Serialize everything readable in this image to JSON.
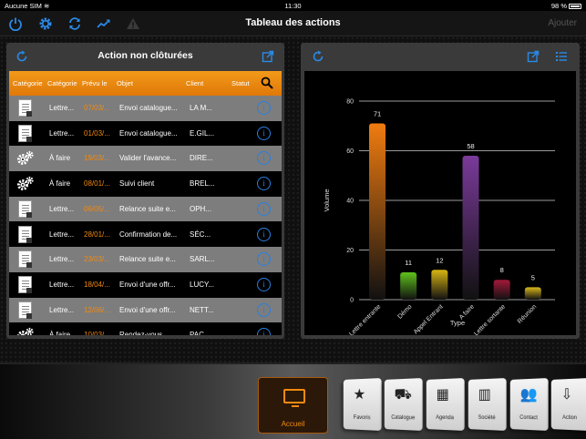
{
  "status_bar": {
    "carrier": "Aucune SIM",
    "time": "11:30",
    "battery": "98 %"
  },
  "nav": {
    "title": "Tableau des actions",
    "add_label": "Ajouter",
    "icons": [
      "power-icon",
      "gear-icon",
      "sync-icon",
      "trend-icon",
      "warning-icon"
    ]
  },
  "left_panel": {
    "title": "Action non clôturées",
    "columns": [
      "Catégorie",
      "Catégorie",
      "Prévu le",
      "Objet",
      "Client",
      "Statut"
    ],
    "rows": [
      {
        "icon": "document-icon",
        "category": "Lettre...",
        "date": "07/03/...",
        "object": "Envoi catalogue...",
        "client": "LA M...",
        "shade": "gray"
      },
      {
        "icon": "document-icon",
        "category": "Lettre...",
        "date": "01/03/...",
        "object": "Envoi catalogue...",
        "client": "E.GIL...",
        "shade": "black"
      },
      {
        "icon": "gears-icon",
        "category": "À faire",
        "date": "19/03/...",
        "object": "Valider l'avance...",
        "client": "DIRE...",
        "shade": "gray"
      },
      {
        "icon": "gears-icon",
        "category": "À faire",
        "date": "08/01/...",
        "object": "Suivi client",
        "client": "BREL...",
        "shade": "black"
      },
      {
        "icon": "document-icon",
        "category": "Lettre...",
        "date": "06/05/...",
        "object": "Relance suite e...",
        "client": "OPH...",
        "shade": "gray"
      },
      {
        "icon": "document-icon",
        "category": "Lettre...",
        "date": "28/01/...",
        "object": "Confirmation de...",
        "client": "SÉC...",
        "shade": "black"
      },
      {
        "icon": "document-icon",
        "category": "Lettre...",
        "date": "23/03/...",
        "object": "Relance suite e...",
        "client": "SARL...",
        "shade": "gray"
      },
      {
        "icon": "document-icon",
        "category": "Lettre...",
        "date": "18/04/...",
        "object": "Envoi d'une offr...",
        "client": "LUCY...",
        "shade": "black"
      },
      {
        "icon": "document-icon",
        "category": "Lettre...",
        "date": "12/06/...",
        "object": "Envoi d'une offr...",
        "client": "NETT...",
        "shade": "gray"
      },
      {
        "icon": "gears-icon",
        "category": "À faire",
        "date": "10/03/...",
        "object": "Rendez-vous...",
        "client": "PAC...",
        "shade": "black"
      }
    ]
  },
  "chart_data": {
    "type": "bar",
    "categories": [
      "Lettre entrante",
      "Démo",
      "Appel Entrant",
      "A faire",
      "Lettre sortante",
      "Réunion"
    ],
    "values": [
      71,
      11,
      12,
      58,
      8,
      5
    ],
    "colors": [
      "#f07c10",
      "#5fc21c",
      "#d8b414",
      "#7a3a9a",
      "#a3193a",
      "#d9b81a"
    ],
    "ylabel": "Volume",
    "xlabel": "Type",
    "ylim": [
      0,
      80
    ],
    "yticks": [
      0,
      20,
      40,
      60,
      80
    ],
    "grid": true
  },
  "dock": {
    "home_label": "Accueil",
    "cards": [
      {
        "label": "Favoris",
        "icon": "star-icon"
      },
      {
        "label": "Catalogue",
        "icon": "cart-icon"
      },
      {
        "label": "Agenda",
        "icon": "calendar-icon"
      },
      {
        "label": "Société",
        "icon": "building-icon"
      },
      {
        "label": "Contact",
        "icon": "people-icon"
      },
      {
        "label": "Action",
        "icon": "action-icon"
      }
    ]
  }
}
